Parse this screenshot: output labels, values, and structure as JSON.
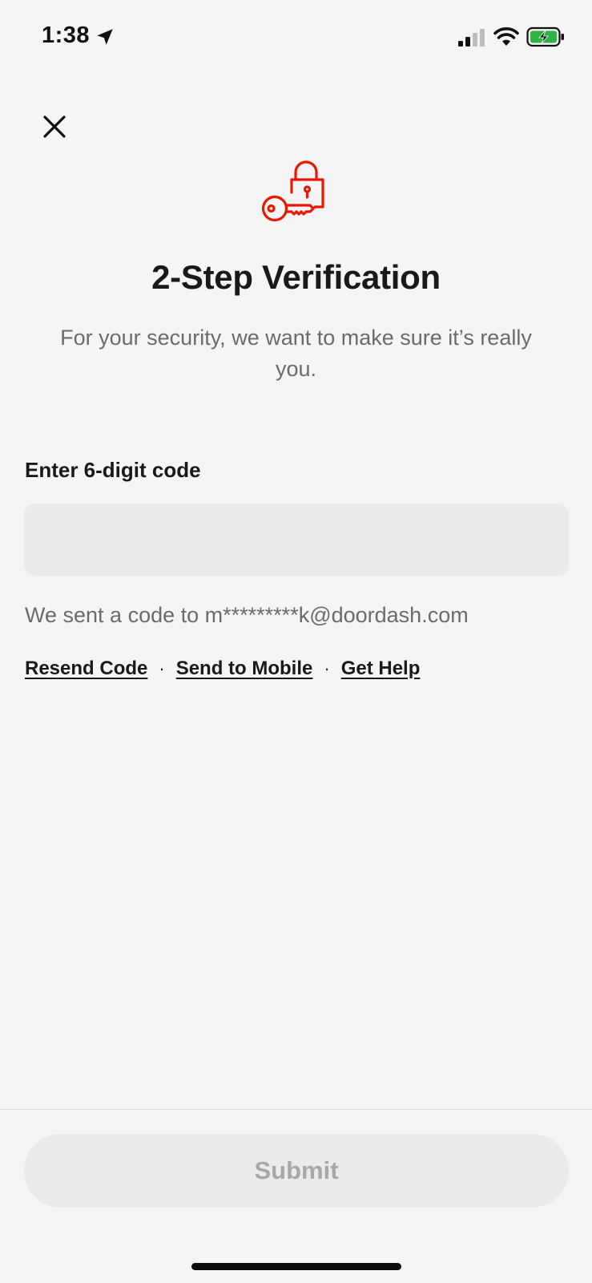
{
  "status_bar": {
    "time": "1:38",
    "icons": [
      "location-arrow-icon",
      "cellular-signal-icon",
      "wifi-icon",
      "battery-charging-icon"
    ],
    "battery_color": "#2fb344"
  },
  "header": {
    "close_icon": "close-icon"
  },
  "hero": {
    "icon": "lock-key-icon",
    "icon_color": "#eb1700",
    "title": "2-Step Verification",
    "subtitle": "For your security, we want to make sure it’s really you."
  },
  "form": {
    "label": "Enter 6-digit code",
    "code_value": "",
    "sent_info": "We sent a code to m*********k@doordash.com",
    "links": {
      "resend": "Resend Code",
      "send_to_mobile": "Send to Mobile",
      "get_help": "Get Help",
      "separator": "·"
    }
  },
  "footer": {
    "submit_label": "Submit",
    "submit_enabled": false
  }
}
